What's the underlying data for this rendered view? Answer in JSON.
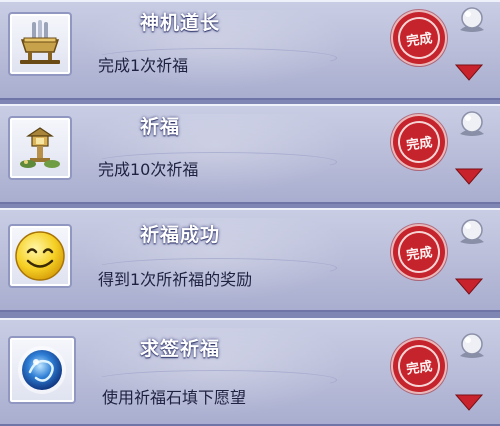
{
  "achievements": [
    {
      "title": "神机道长",
      "description": "完成1次祈福",
      "icon": "incense-burner-icon",
      "status_stamp": "完成"
    },
    {
      "title": "祈福",
      "description": "完成10次祈福",
      "icon": "stone-lantern-icon",
      "status_stamp": "完成"
    },
    {
      "title": "祈福成功",
      "description": "得到1次所祈福的奖励",
      "icon": "smiley-face-icon",
      "status_stamp": "完成"
    },
    {
      "title": "求签祈福",
      "description": "使用祈福石填下愿望",
      "icon": "blessing-stone-orb-icon",
      "status_stamp": "完成"
    }
  ],
  "colors": {
    "stamp_red": "#c6242c",
    "arrow_red": "#c8232d",
    "panel_lavender": "#b8bcd8",
    "title_white": "#ffffff",
    "desc_dark": "#1f2140"
  }
}
